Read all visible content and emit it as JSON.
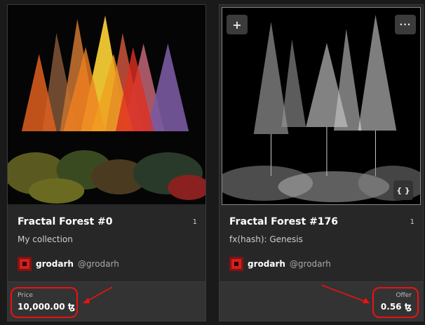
{
  "cards": [
    {
      "title": "Fractal Forest #0",
      "edition": "1",
      "subtitle": "My collection",
      "author_name": "grodarh",
      "author_handle": "@grodarh",
      "price_label": "Price",
      "price_value": "10,000.00 ꜩ"
    },
    {
      "title": "Fractal Forest #176",
      "edition": "1",
      "subtitle": "fx(hash): Genesis",
      "author_name": "grodarh",
      "author_handle": "@grodarh",
      "price_label": "Offer",
      "price_value": "0.56 ꜩ",
      "buttons": {
        "add": "+",
        "more": "···",
        "code": "{ }"
      }
    }
  ],
  "icons": [
    "plus-icon",
    "more-icon",
    "code-icon",
    "avatar"
  ],
  "colors": {
    "highlight": "#ee1111",
    "card_bg": "#272727",
    "footer_bg": "#333333"
  }
}
